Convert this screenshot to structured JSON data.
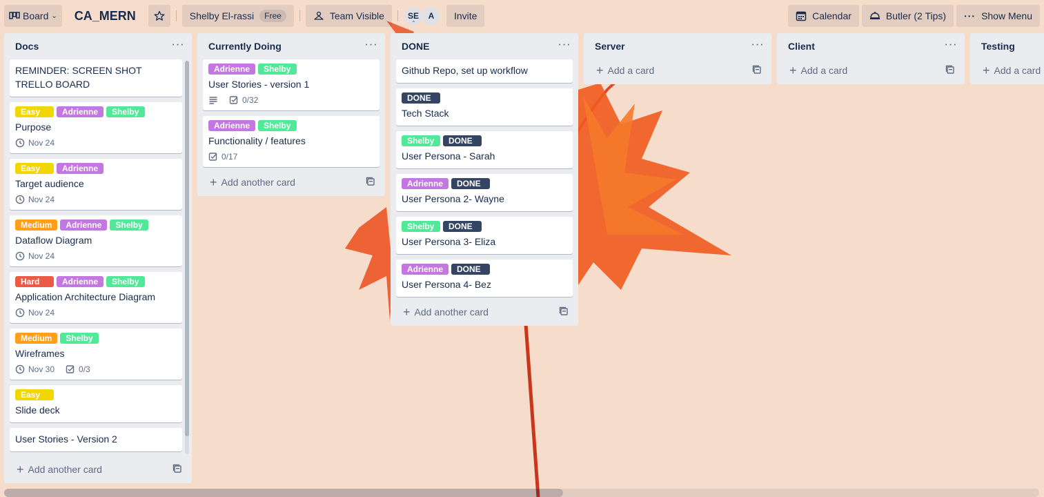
{
  "header": {
    "board_switcher": "Board",
    "board_title": "CA_MERN",
    "workspace_name": "Shelby El-rassi",
    "workspace_badge": "Free",
    "visibility": "Team Visible",
    "members": [
      "SE",
      "A"
    ],
    "invite": "Invite",
    "calendar": "Calendar",
    "butler": "Butler (2 Tips)",
    "show_menu": "Show Menu"
  },
  "colors": {
    "easy": "#f2d600",
    "medium": "#ff9f1a",
    "hard": "#eb5a46",
    "adrienne": "#c377e0",
    "shelby": "#51e898",
    "done": "#344563"
  },
  "lists": [
    {
      "title": "Docs",
      "footer": "Add another card",
      "cards": [
        {
          "title": "REMINDER: SCREEN SHOT TRELLO BOARD",
          "labels": [],
          "due": "",
          "checklist": "",
          "desc": false
        },
        {
          "title": "Purpose",
          "labels": [
            {
              "text": "Easy",
              "color": "#f2d600"
            },
            {
              "text": "Adrienne",
              "color": "#c377e0"
            },
            {
              "text": "Shelby",
              "color": "#51e898"
            }
          ],
          "due": "Nov 24",
          "checklist": "",
          "desc": false
        },
        {
          "title": "Target audience",
          "labels": [
            {
              "text": "Easy",
              "color": "#f2d600"
            },
            {
              "text": "Adrienne",
              "color": "#c377e0"
            }
          ],
          "due": "Nov 24",
          "checklist": "",
          "desc": false
        },
        {
          "title": "Dataflow Diagram",
          "labels": [
            {
              "text": "Medium",
              "color": "#ff9f1a"
            },
            {
              "text": "Adrienne",
              "color": "#c377e0"
            },
            {
              "text": "Shelby",
              "color": "#51e898"
            }
          ],
          "due": "Nov 24",
          "checklist": "",
          "desc": false
        },
        {
          "title": "Application Architecture Diagram",
          "labels": [
            {
              "text": "Hard",
              "color": "#eb5a46"
            },
            {
              "text": "Adrienne",
              "color": "#c377e0"
            },
            {
              "text": "Shelby",
              "color": "#51e898"
            }
          ],
          "due": "Nov 24",
          "checklist": "",
          "desc": false
        },
        {
          "title": "Wireframes",
          "labels": [
            {
              "text": "Medium",
              "color": "#ff9f1a"
            },
            {
              "text": "Shelby",
              "color": "#51e898"
            }
          ],
          "due": "Nov 30",
          "checklist": "0/3",
          "desc": false
        },
        {
          "title": "Slide deck",
          "labels": [
            {
              "text": "Easy",
              "color": "#f2d600"
            }
          ],
          "due": "",
          "checklist": "",
          "desc": false
        },
        {
          "title": "User Stories - Version 2",
          "labels": [],
          "due": "",
          "checklist": "",
          "desc": false
        }
      ]
    },
    {
      "title": "Currently Doing",
      "footer": "Add another card",
      "cards": [
        {
          "title": "User Stories - version 1",
          "labels": [
            {
              "text": "Adrienne",
              "color": "#c377e0"
            },
            {
              "text": "Shelby",
              "color": "#51e898"
            }
          ],
          "due": "",
          "checklist": "0/32",
          "desc": true
        },
        {
          "title": "Functionality / features",
          "labels": [
            {
              "text": "Adrienne",
              "color": "#c377e0"
            },
            {
              "text": "Shelby",
              "color": "#51e898"
            }
          ],
          "due": "",
          "checklist": "0/17",
          "desc": false
        }
      ]
    },
    {
      "title": "DONE",
      "footer": "Add another card",
      "cards": [
        {
          "title": "Github Repo, set up workflow",
          "labels": [],
          "due": "",
          "checklist": "",
          "desc": false
        },
        {
          "title": "Tech Stack",
          "labels": [
            {
              "text": "DONE",
              "color": "#344563"
            }
          ],
          "due": "",
          "checklist": "",
          "desc": false
        },
        {
          "title": "User Persona - Sarah",
          "labels": [
            {
              "text": "Shelby",
              "color": "#51e898"
            },
            {
              "text": "DONE",
              "color": "#344563"
            }
          ],
          "due": "",
          "checklist": "",
          "desc": false
        },
        {
          "title": "User Persona 2- Wayne",
          "labels": [
            {
              "text": "Adrienne",
              "color": "#c377e0"
            },
            {
              "text": "DONE",
              "color": "#344563"
            }
          ],
          "due": "",
          "checklist": "",
          "desc": false
        },
        {
          "title": "User Persona 3- Eliza",
          "labels": [
            {
              "text": "Shelby",
              "color": "#51e898"
            },
            {
              "text": "DONE",
              "color": "#344563"
            }
          ],
          "due": "",
          "checklist": "",
          "desc": false
        },
        {
          "title": "User Persona 4- Bez",
          "labels": [
            {
              "text": "Adrienne",
              "color": "#c377e0"
            },
            {
              "text": "DONE",
              "color": "#344563"
            }
          ],
          "due": "",
          "checklist": "",
          "desc": false
        }
      ]
    },
    {
      "title": "Server",
      "footer": "Add a card",
      "cards": []
    },
    {
      "title": "Client",
      "footer": "Add a card",
      "cards": []
    },
    {
      "title": "Testing",
      "footer": "Add a card",
      "cards": []
    }
  ]
}
